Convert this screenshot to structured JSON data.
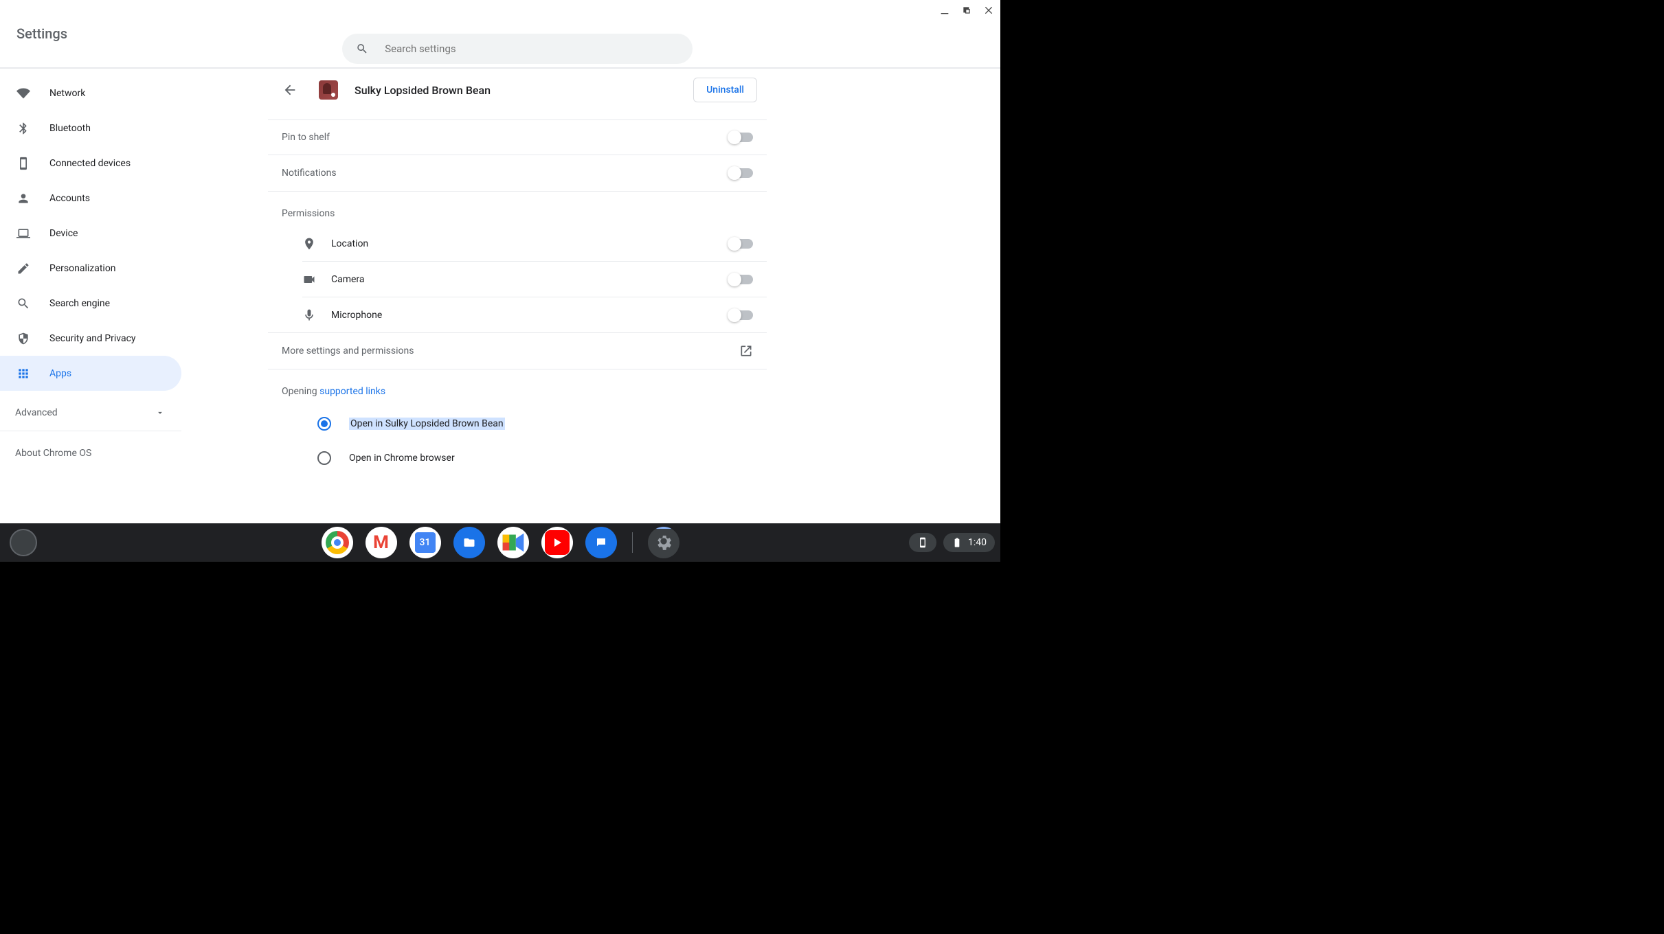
{
  "window": {
    "title": "Settings"
  },
  "search": {
    "placeholder": "Search settings"
  },
  "sidebar": {
    "items": [
      {
        "label": "Network"
      },
      {
        "label": "Bluetooth"
      },
      {
        "label": "Connected devices"
      },
      {
        "label": "Accounts"
      },
      {
        "label": "Device"
      },
      {
        "label": "Personalization"
      },
      {
        "label": "Search engine"
      },
      {
        "label": "Security and Privacy"
      },
      {
        "label": "Apps"
      }
    ],
    "advanced": "Advanced",
    "about": "About Chrome OS"
  },
  "detail": {
    "app_name": "Sulky Lopsided Brown Bean",
    "uninstall": "Uninstall",
    "pin_to_shelf": "Pin to shelf",
    "notifications": "Notifications",
    "permissions_label": "Permissions",
    "permissions": {
      "location": "Location",
      "camera": "Camera",
      "microphone": "Microphone"
    },
    "more": "More settings and permissions",
    "opening_prefix": "Opening ",
    "opening_link": "supported links",
    "radio_open_app": "Open in Sulky Lopsided Brown Bean",
    "radio_open_chrome": "Open in Chrome browser"
  },
  "shelf": {
    "calendar_day": "31",
    "time": "1:40"
  }
}
